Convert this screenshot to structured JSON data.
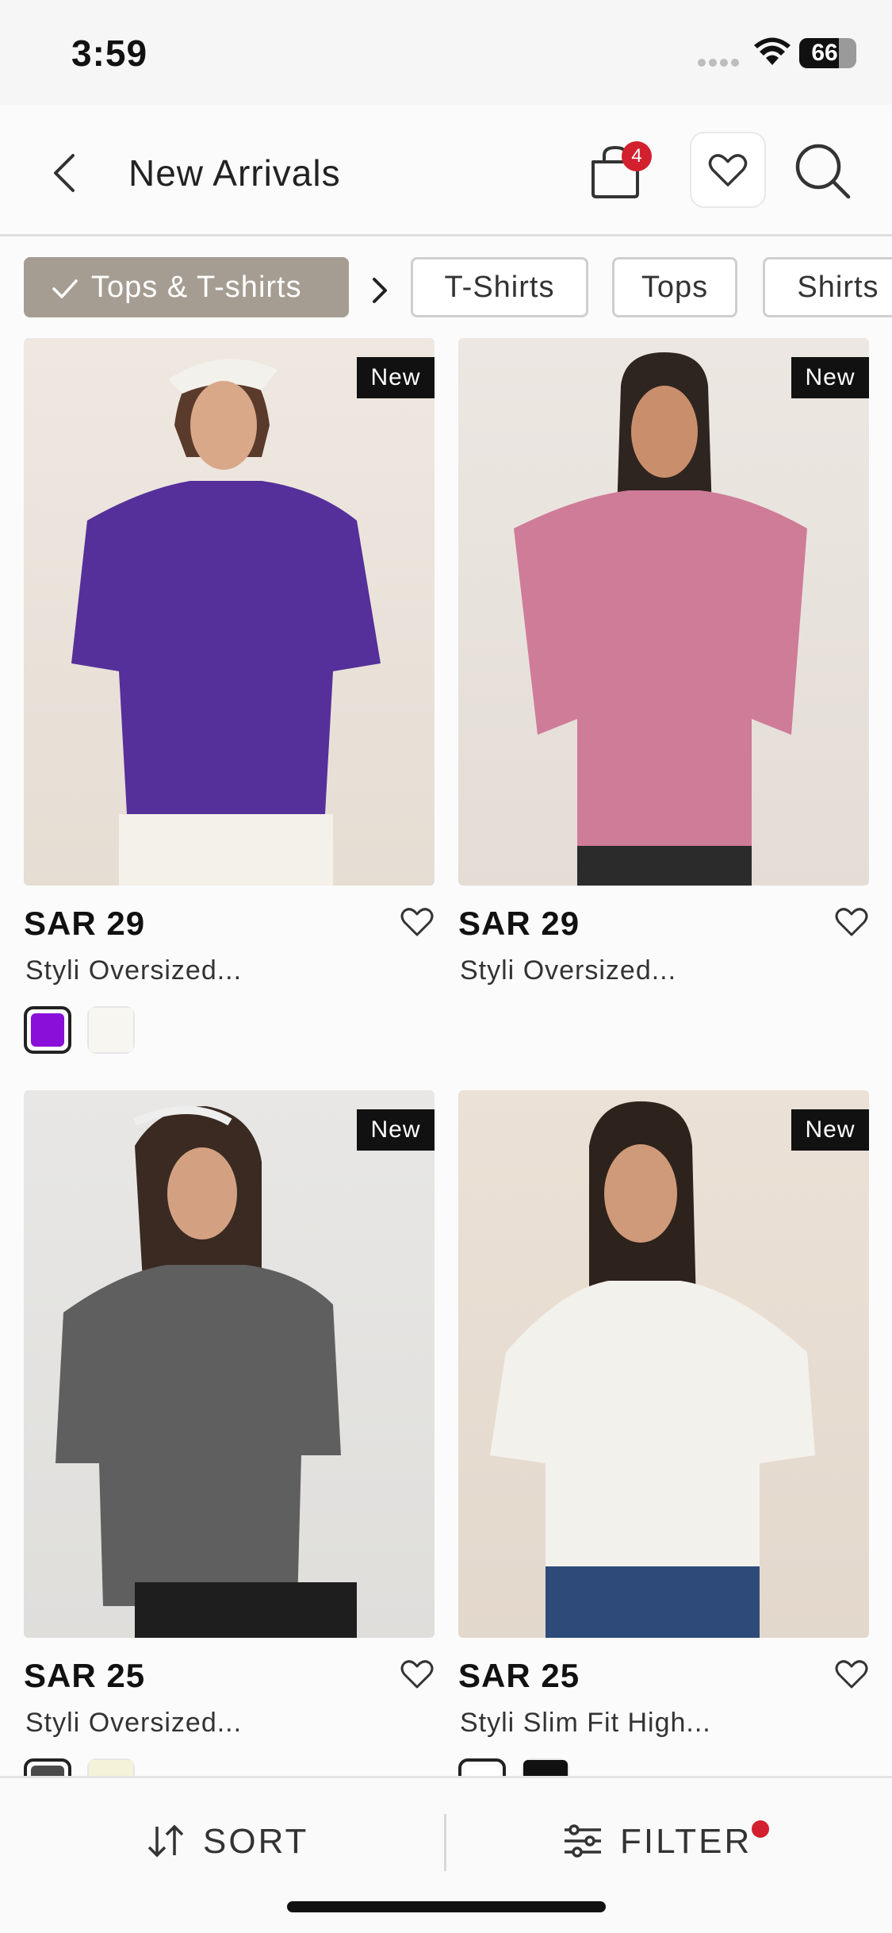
{
  "status_bar": {
    "time": "3:59",
    "battery": "66",
    "battery_level_pct": 66
  },
  "header": {
    "title": "New Arrivals",
    "bag_count": "4",
    "back_icon": "chevron-left-icon",
    "bag_icon": "shopping-bag-icon",
    "wishlist_icon": "heart-icon",
    "search_icon": "search-icon"
  },
  "chips": {
    "active_label": "Tops & T-shirts",
    "items": [
      {
        "label": "T-Shirts"
      },
      {
        "label": "Tops"
      },
      {
        "label": "Shirts"
      }
    ]
  },
  "products": [
    {
      "badge": "New",
      "price": "SAR 29",
      "brand": "Styli",
      "name": "Oversized...",
      "shirt_color": "#55309a",
      "swatches": [
        "#8a0fd8",
        "#f7f6f1"
      ],
      "selected_swatch": 0
    },
    {
      "badge": "New",
      "price": "SAR 29",
      "brand": "Styli",
      "name": "Oversized...",
      "shirt_color": "#cf7c98",
      "swatches": [],
      "selected_swatch": null
    },
    {
      "badge": "New",
      "price": "SAR 25",
      "brand": "Styli",
      "name": "Oversized...",
      "shirt_color": "#5f5f5f",
      "swatches": [
        "#4a4a4a",
        "#f4f2d8"
      ],
      "selected_swatch": 0
    },
    {
      "badge": "New",
      "price": "SAR 25",
      "brand": "Styli",
      "name": "Slim Fit High...",
      "shirt_color": "#f3f1ec",
      "swatches": [
        "#ffffff",
        "#111111"
      ],
      "selected_swatch": 0
    }
  ],
  "bottom_bar": {
    "sort_label": "SORT",
    "filter_label": "FILTER",
    "sort_icon": "sort-arrows-icon",
    "filter_icon": "sliders-icon"
  },
  "colors": {
    "accent_chip": "#a69d92",
    "badge_red": "#d2202f"
  }
}
